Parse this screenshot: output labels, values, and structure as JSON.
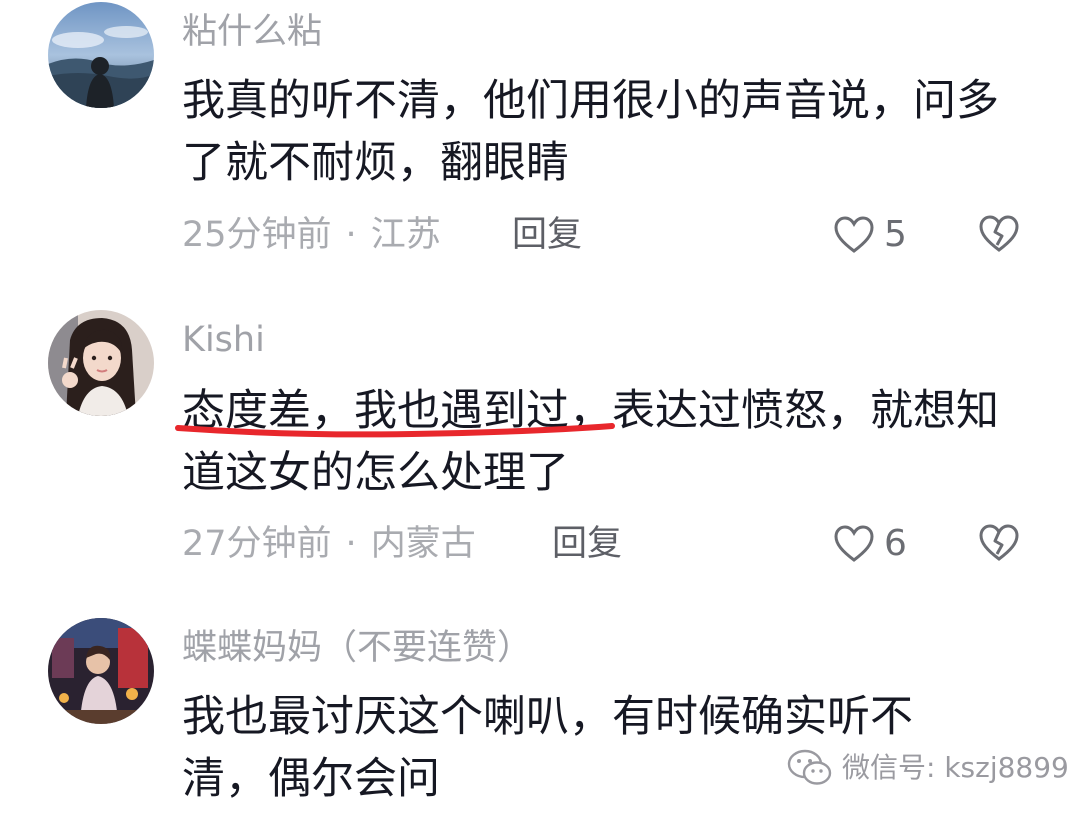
{
  "comments": [
    {
      "username": "粘什么粘",
      "text": "我真的听不清，他们用很小的声音说，问多了就不耐烦，翻眼睛",
      "time": "25分钟前",
      "location": "江苏",
      "reply_label": "回复",
      "likes": "5"
    },
    {
      "username": "Kishi",
      "text": "态度差，我也遇到过，表达过愤怒，就想知道这女的怎么处理了",
      "time": "27分钟前",
      "location": "内蒙古",
      "reply_label": "回复",
      "likes": "6"
    },
    {
      "username": "蝶蝶妈妈（不要连赞）",
      "text": "我也最讨厌这个喇叭，有时候确实听不清，偶尔会问"
    }
  ],
  "meta_separator": "·",
  "watermark": {
    "text": "微信号: kszj8899",
    "icon": "wechat-icon"
  },
  "colors": {
    "underline": "#e8272c",
    "muted": "#a9abb0",
    "text": "#161823"
  }
}
